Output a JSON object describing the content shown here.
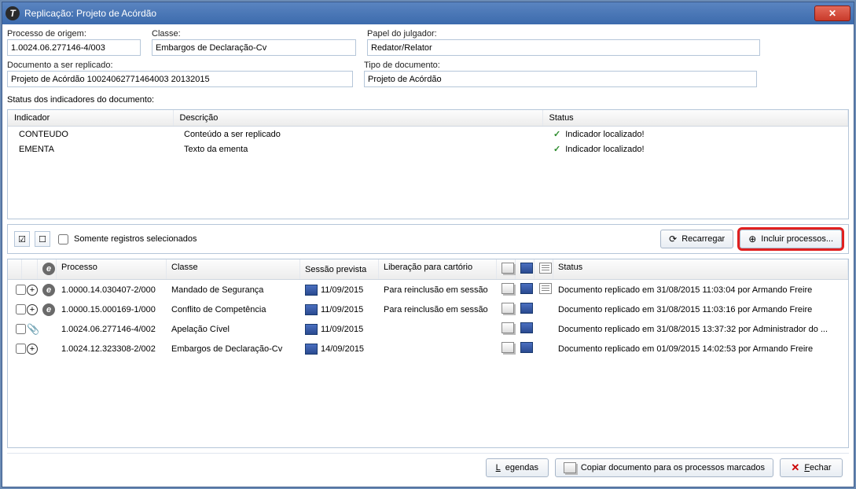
{
  "window": {
    "title": "Replicação: Projeto de Acórdão"
  },
  "form": {
    "processo_origem_label": "Processo de origem:",
    "processo_origem_value": "1.0024.06.277146-4/003",
    "classe_label": "Classe:",
    "classe_value": "Embargos de Declaração-Cv",
    "papel_label": "Papel do julgador:",
    "papel_value": "Redator/Relator",
    "doc_label": "Documento a ser replicado:",
    "doc_value": "Projeto de Acórdão 10024062771464003 20132015",
    "tipo_label": "Tipo de documento:",
    "tipo_value": "Projeto de Acórdão"
  },
  "indicadores": {
    "section_label": "Status dos indicadores do documento:",
    "headers": {
      "indicador": "Indicador",
      "descricao": "Descrição",
      "status": "Status"
    },
    "rows": [
      {
        "indicador": "CONTEUDO",
        "descricao": "Conteúdo a ser replicado",
        "status": "Indicador localizado!"
      },
      {
        "indicador": "EMENTA",
        "descricao": "Texto da ementa",
        "status": "Indicador localizado!"
      }
    ]
  },
  "toolbar": {
    "somente_label": "Somente registros selecionados",
    "recarregar": "Recarregar",
    "incluir": "Incluir processos..."
  },
  "grid": {
    "headers": {
      "processo": "Processo",
      "classe": "Classe",
      "sessao": "Sessão prevista",
      "liberacao": "Liberação para cartório",
      "status": "Status"
    },
    "rows": [
      {
        "eicon": true,
        "action": "plus",
        "processo": "1.0000.14.030407-2/000",
        "classe": "Mandado de Segurança",
        "sessao": "11/09/2015",
        "liberacao": "Para reinclusão em sessão",
        "i1": true,
        "i2": true,
        "i3": true,
        "status": "Documento replicado em 31/08/2015 11:03:04 por Armando Freire"
      },
      {
        "eicon": true,
        "action": "plus",
        "processo": "1.0000.15.000169-1/000",
        "classe": "Conflito de Competência",
        "sessao": "11/09/2015",
        "liberacao": "Para reinclusão em sessão",
        "i1": true,
        "i2": true,
        "i3": false,
        "status": "Documento replicado em 31/08/2015 11:03:16 por Armando Freire"
      },
      {
        "eicon": false,
        "action": "clip",
        "processo": "1.0024.06.277146-4/002",
        "classe": "Apelação Cível",
        "sessao": "11/09/2015",
        "liberacao": "",
        "i1": true,
        "i2": true,
        "i3": false,
        "status": "Documento replicado em 31/08/2015 13:37:32 por Administrador do ..."
      },
      {
        "eicon": false,
        "action": "plus",
        "processo": "1.0024.12.323308-2/002",
        "classe": "Embargos de Declaração-Cv",
        "sessao": "14/09/2015",
        "liberacao": "",
        "i1": true,
        "i2": true,
        "i3": false,
        "status": "Documento replicado em 01/09/2015 14:02:53 por Armando Freire"
      }
    ]
  },
  "footer": {
    "legendas": "egendas",
    "legendas_accel": "L",
    "copiar": "Copiar documento para os processos marcados",
    "fechar": "echar",
    "fechar_accel": "F"
  }
}
